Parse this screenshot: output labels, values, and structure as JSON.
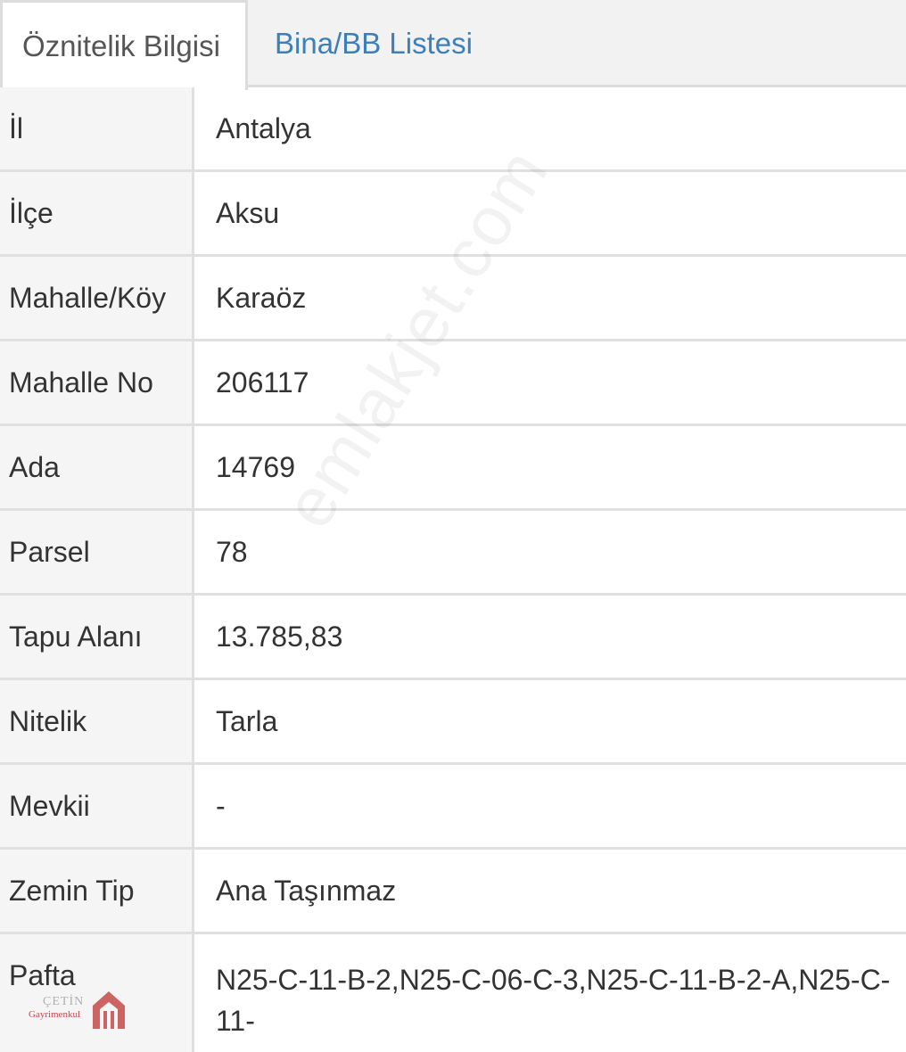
{
  "tabs": [
    {
      "label": "Öznitelik Bilgisi",
      "active": true
    },
    {
      "label": "Bina/BB Listesi",
      "active": false
    }
  ],
  "rows": [
    {
      "label": "İl",
      "value": "Antalya"
    },
    {
      "label": "İlçe",
      "value": "Aksu"
    },
    {
      "label": "Mahalle/Köy",
      "value": "Karaöz"
    },
    {
      "label": "Mahalle No",
      "value": "206117"
    },
    {
      "label": "Ada",
      "value": "14769"
    },
    {
      "label": "Parsel",
      "value": "78"
    },
    {
      "label": "Tapu Alanı",
      "value": "13.785,83"
    },
    {
      "label": "Nitelik",
      "value": "Tarla"
    },
    {
      "label": "Mevkii",
      "value": "-"
    },
    {
      "label": "Zemin Tip",
      "value": "Ana Taşınmaz"
    },
    {
      "label": "Pafta",
      "value": "N25-C-11-B-2,N25-C-06-C-3,N25-C-11-B-2-A,N25-C-11-"
    }
  ],
  "watermark": {
    "text": "emlakjet.com"
  },
  "logo": {
    "name": "ÇETİN",
    "subtitle": "Gayrimenkul"
  },
  "colors": {
    "tab_link": "#3d7fb8",
    "label_bg": "#f5f5f5",
    "border": "#e0e0e0",
    "logo_accent": "#c44a4a"
  }
}
